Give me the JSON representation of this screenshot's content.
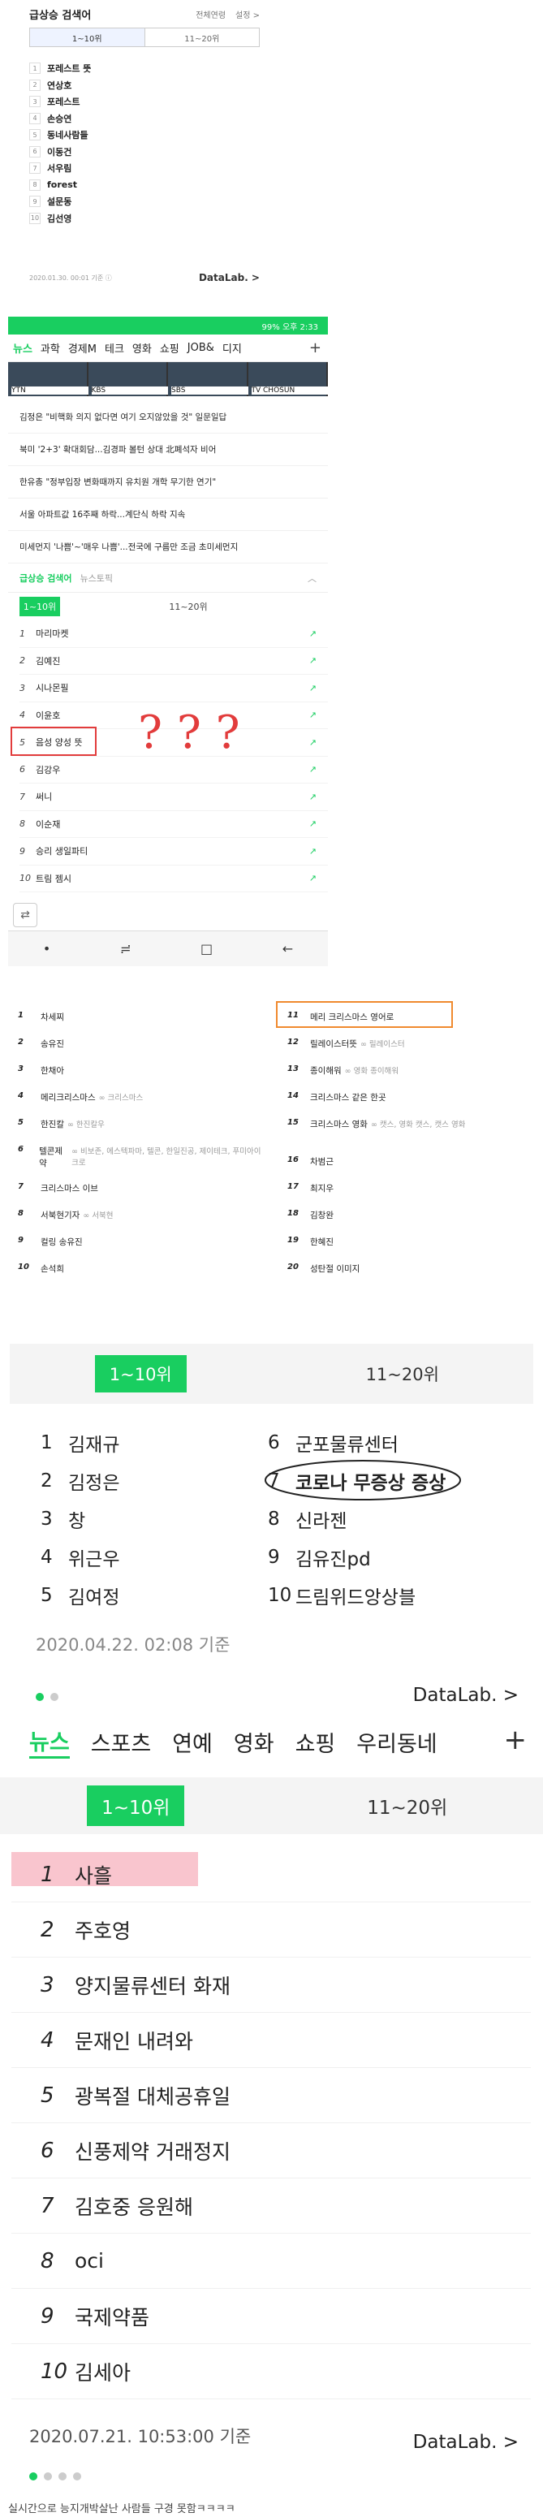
{
  "colors": {
    "accent": "#19ce60",
    "highlight_marker": "#f7b2bd",
    "box_outline": "#f08a2e"
  },
  "section1": {
    "title": "급상승 검색어",
    "right_links": [
      "전체연령",
      "설정 >"
    ],
    "tabs": [
      "1~10위",
      "11~20위"
    ],
    "items": [
      {
        "rank": "1",
        "text": "포레스트 뜻"
      },
      {
        "rank": "2",
        "text": "연상호"
      },
      {
        "rank": "3",
        "text": "포레스트"
      },
      {
        "rank": "4",
        "text": "손승연"
      },
      {
        "rank": "5",
        "text": "동네사람들"
      },
      {
        "rank": "6",
        "text": "이동건"
      },
      {
        "rank": "7",
        "text": "서우림"
      },
      {
        "rank": "8",
        "text": "forest"
      },
      {
        "rank": "9",
        "text": "설문동"
      },
      {
        "rank": "10",
        "text": "김선영"
      }
    ],
    "timestamp": "2020.01.30. 00:01 기준 ⓘ",
    "datalab": "DataLab. >"
  },
  "section2": {
    "status": "99% 오후 2:33",
    "tabs": [
      "뉴스",
      "과학",
      "경제M",
      "테크",
      "영화",
      "쇼핑",
      "JOB&",
      "디지"
    ],
    "channels": [
      "YTN",
      "KBS",
      "SBS",
      "TV CHOSUN"
    ],
    "headlines": [
      "김정은 \"비핵화 의지 없다면 여기 오지않았을 것\"   일문일답",
      "북미 '2+3' 확대회담...김경파 볼턴 상대 北폐석자 비어",
      "한유총 \"정부입장 변화때까지 유치원 개학 무기한 연기\"",
      "서울 아파트값 16주째 하락...계단식 하락 지속",
      "미세먼지 '나쁨'~'매우 나쁨'...전국에 구름만 조금   초미세먼지"
    ],
    "kw_title": "급상승 검색어",
    "kw_sub": "뉴스토픽",
    "kw_tabs": [
      "1~10위",
      "11~20위"
    ],
    "items": [
      {
        "rank": "1",
        "text": "마리마켓"
      },
      {
        "rank": "2",
        "text": "김예진"
      },
      {
        "rank": "3",
        "text": "시나몬필"
      },
      {
        "rank": "4",
        "text": "이윤호"
      },
      {
        "rank": "5",
        "text": "음성 양성 뜻"
      },
      {
        "rank": "6",
        "text": "김강우"
      },
      {
        "rank": "7",
        "text": "써니"
      },
      {
        "rank": "8",
        "text": "이순재"
      },
      {
        "rank": "9",
        "text": "승리 생일파티"
      },
      {
        "rank": "10",
        "text": "트림 젬시"
      }
    ],
    "handwriting": "? ? ?"
  },
  "section3": {
    "left": [
      {
        "rank": "1",
        "text": "차세찌",
        "rel": ""
      },
      {
        "rank": "2",
        "text": "송유진",
        "rel": ""
      },
      {
        "rank": "3",
        "text": "한채아",
        "rel": ""
      },
      {
        "rank": "4",
        "text": "메리크리스마스",
        "rel": "∞ 크리스마스"
      },
      {
        "rank": "5",
        "text": "한진칼",
        "rel": "∞ 한진칼우"
      },
      {
        "rank": "6",
        "text": "텔콘제약",
        "rel": "∞ 비보존, 에스텍파마, 텔콘, 한일진공, 제이테크, 푸미아이크로"
      },
      {
        "rank": "7",
        "text": "크리스마스 이브",
        "rel": ""
      },
      {
        "rank": "8",
        "text": "서북현기자",
        "rel": "∞ 서북현"
      },
      {
        "rank": "9",
        "text": "컬링 송유진",
        "rel": ""
      },
      {
        "rank": "10",
        "text": "손석희",
        "rel": ""
      }
    ],
    "right": [
      {
        "rank": "11",
        "text": "메리 크리스마스 영어로",
        "rel": ""
      },
      {
        "rank": "12",
        "text": "릴레이스터뜻",
        "rel": "∞ 릴레이스터"
      },
      {
        "rank": "13",
        "text": "종이해워",
        "rel": "∞ 영화 종이해워"
      },
      {
        "rank": "14",
        "text": "크리스마스 같은 한곳",
        "rel": ""
      },
      {
        "rank": "15",
        "text": "크리스마스 영화",
        "rel": "∞ 캣스, 영화 캣스, 캣스 영화"
      },
      {
        "rank": "16",
        "text": "차범근",
        "rel": ""
      },
      {
        "rank": "17",
        "text": "최지우",
        "rel": ""
      },
      {
        "rank": "18",
        "text": "김창완",
        "rel": ""
      },
      {
        "rank": "19",
        "text": "한혜진",
        "rel": ""
      },
      {
        "rank": "20",
        "text": "성탄절 이미지",
        "rel": ""
      }
    ]
  },
  "section4": {
    "tabs": [
      "1~10위",
      "11~20위"
    ],
    "left": [
      {
        "rank": "1",
        "text": "김재규"
      },
      {
        "rank": "2",
        "text": "김정은"
      },
      {
        "rank": "3",
        "text": "창"
      },
      {
        "rank": "4",
        "text": "위근우"
      },
      {
        "rank": "5",
        "text": "김여정"
      }
    ],
    "right": [
      {
        "rank": "6",
        "text": "군포물류센터"
      },
      {
        "rank": "7",
        "text": "코로나 무증상 증상"
      },
      {
        "rank": "8",
        "text": "신라젠"
      },
      {
        "rank": "9",
        "text": "김유진pd"
      },
      {
        "rank": "10",
        "text": "드림위드앙상블"
      }
    ],
    "timestamp": "2020.04.22. 02:08 기준",
    "datalab": "DataLab. >"
  },
  "section5": {
    "nav": [
      "뉴스",
      "스포츠",
      "연예",
      "영화",
      "쇼핑",
      "우리동네"
    ],
    "plus": "+",
    "tabs": [
      "1~10위",
      "11~20위"
    ],
    "items": [
      {
        "rank": "1",
        "text": "사흘"
      },
      {
        "rank": "2",
        "text": "주호영"
      },
      {
        "rank": "3",
        "text": "양지물류센터 화재"
      },
      {
        "rank": "4",
        "text": "문재인 내려와"
      },
      {
        "rank": "5",
        "text": "광복절 대체공휴일"
      },
      {
        "rank": "6",
        "text": "신풍제약 거래정지"
      },
      {
        "rank": "7",
        "text": "김호중 응원해"
      },
      {
        "rank": "8",
        "text": "oci"
      },
      {
        "rank": "9",
        "text": "국제약품"
      },
      {
        "rank": "10",
        "text": "김세아"
      }
    ],
    "timestamp": "2020.07.21. 10:53:00 기준",
    "datalab": "DataLab. >",
    "caption": "실시간으로 능지개박살난 사람들 구경 못함ㅋㅋㅋㅋ"
  }
}
